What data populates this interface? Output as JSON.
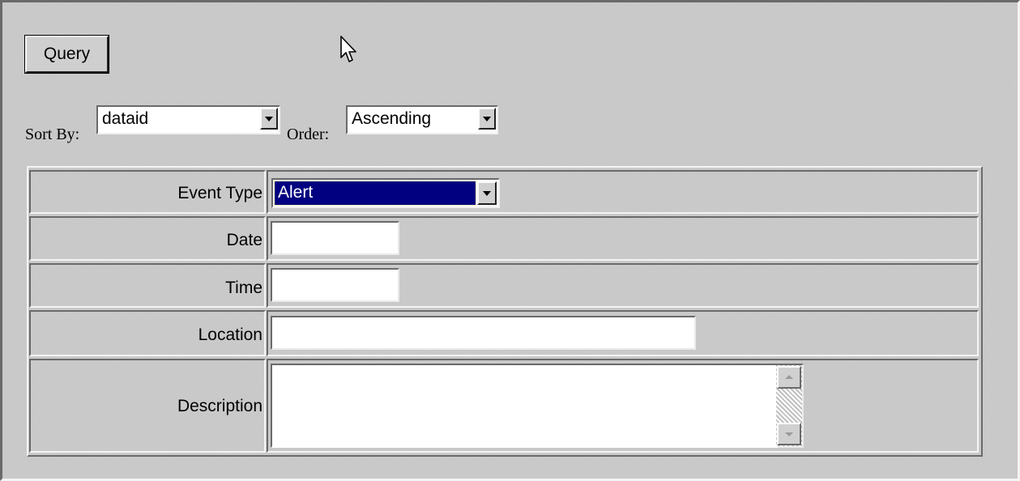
{
  "toolbar": {
    "query_label": "Query"
  },
  "sort": {
    "sort_by_label": "Sort By:",
    "sort_by_value": "dataid",
    "order_label": "Order:",
    "order_value": "Ascending"
  },
  "form": {
    "event_type_label": "Event Type",
    "event_type_value": "Alert",
    "date_label": "Date",
    "date_value": "",
    "time_label": "Time",
    "time_value": "",
    "location_label": "Location",
    "location_value": "",
    "description_label": "Description",
    "description_value": ""
  },
  "colors": {
    "background": "#c8c8c8",
    "selection": "#000080"
  },
  "icons": {
    "cursor": "mouse-pointer-icon",
    "dropdown": "chevron-down-icon",
    "scroll_up": "scroll-up-arrow-icon",
    "scroll_down": "scroll-down-arrow-icon"
  }
}
